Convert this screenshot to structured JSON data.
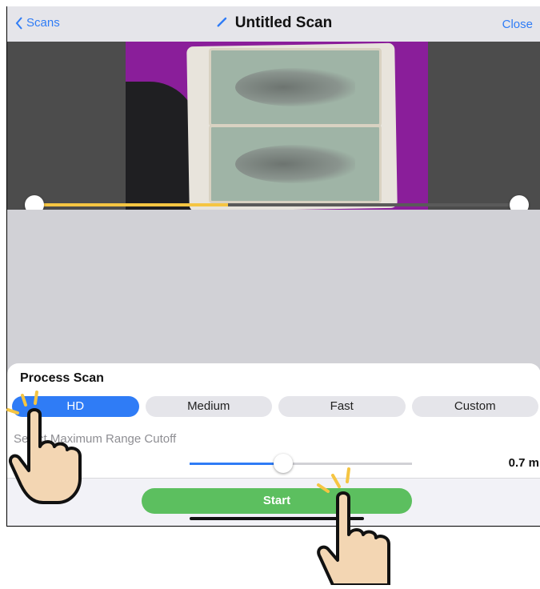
{
  "navbar": {
    "back_label": "Scans",
    "title": "Untitled Scan",
    "close_label": "Close"
  },
  "preview": {
    "trim_start": 0.0,
    "trim_end": 1.0,
    "playback_progress": 0.4
  },
  "sheet": {
    "title": "Process Scan",
    "quality_options": [
      "HD",
      "Medium",
      "Fast",
      "Custom"
    ],
    "selected_quality": "HD",
    "range_label": "Select Maximum Range Cutoff",
    "range_value": "0.7 m",
    "range_fraction": 0.42,
    "start_label": "Start"
  },
  "colors": {
    "accent": "#2f7cf6",
    "start_green": "#5cbf5f",
    "progress_yellow": "#f5c542"
  }
}
